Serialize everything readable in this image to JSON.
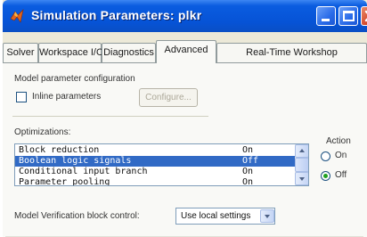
{
  "window": {
    "title": "Simulation Parameters: plkr",
    "colors": {
      "titlebar": "#0653d6",
      "close": "#d4482a",
      "selection": "#316ac5",
      "radio_dot": "#21a121"
    }
  },
  "titlebar_icons": [
    "matlab-icon",
    "minimize-icon",
    "maximize-icon",
    "close-icon"
  ],
  "tabs": [
    {
      "label": "Solver",
      "active": false
    },
    {
      "label": "Workspace I/O",
      "active": false
    },
    {
      "label": "Diagnostics",
      "active": false
    },
    {
      "label": "Advanced",
      "active": true
    },
    {
      "label": "Real-Time Workshop",
      "active": false
    }
  ],
  "advanced": {
    "model_param_config_label": "Model parameter configuration",
    "inline_params": {
      "label": "Inline parameters",
      "checked": false
    },
    "configure_label": "Configure...",
    "optimizations_label": "Optimizations:",
    "optimizations": [
      {
        "name": "Block reduction",
        "value": "On",
        "selected": false
      },
      {
        "name": "Boolean logic signals",
        "value": "Off",
        "selected": true
      },
      {
        "name": "Conditional input branch",
        "value": "On",
        "selected": false
      },
      {
        "name": "Parameter pooling",
        "value": "On",
        "selected": false
      }
    ],
    "action": {
      "label": "Action",
      "options": [
        {
          "label": "On",
          "selected": false
        },
        {
          "label": "Off",
          "selected": true
        }
      ]
    },
    "model_verification": {
      "label": "Model Verification block control:",
      "selected": "Use local settings"
    }
  }
}
